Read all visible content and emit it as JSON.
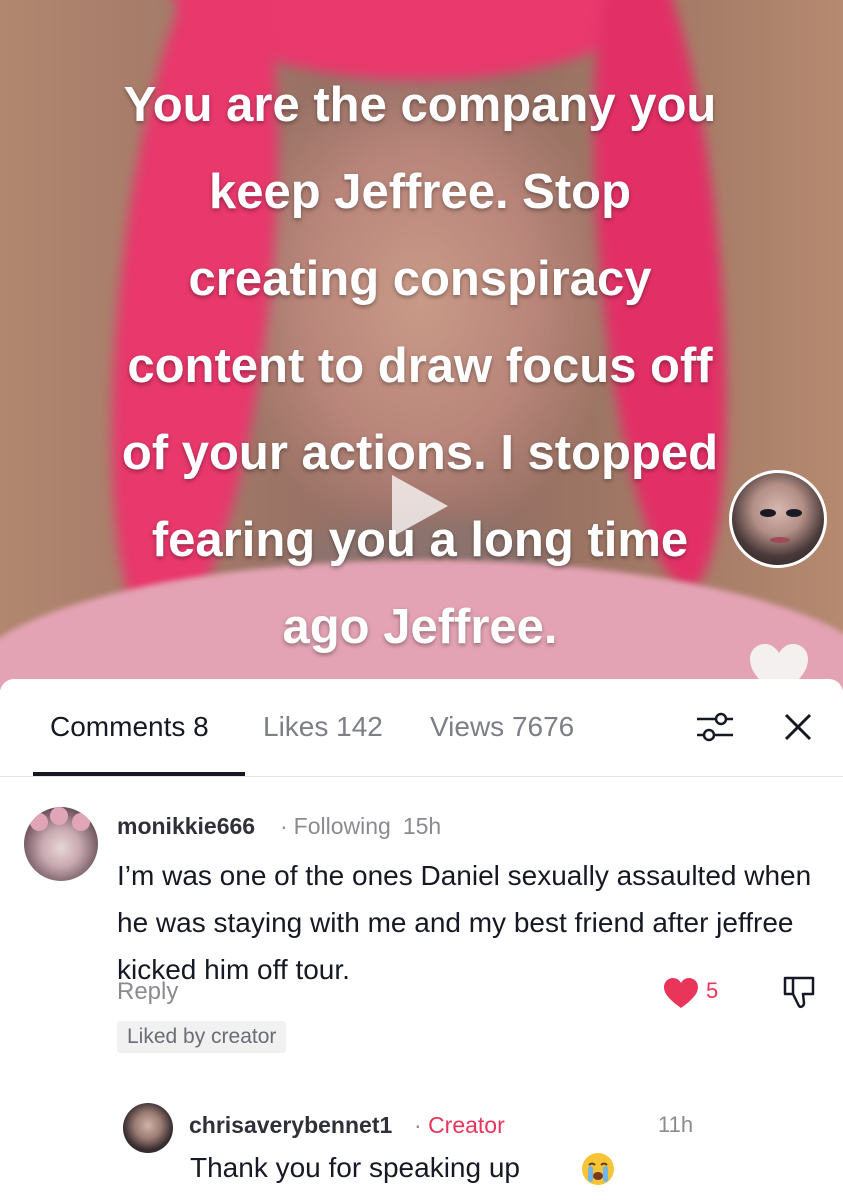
{
  "video": {
    "overlay_lines": [
      "You are the company you",
      "keep Jeffree. Stop",
      "creating conspiracy",
      "content to draw focus off",
      "of your actions. I stopped",
      "fearing you a long time",
      "ago Jeffree."
    ]
  },
  "tabs": {
    "comments": "Comments 8",
    "likes": "Likes 142",
    "views": "Views 7676"
  },
  "comment": {
    "username": "monikkie666",
    "relationship": "Following",
    "time": "15h",
    "text": "I’m was one of the ones Daniel sexually assaulted when he was staying with me and my best friend after jeffree kicked him off tour.",
    "reply_label": "Reply",
    "like_count": "5",
    "liked_badge": "Liked by creator"
  },
  "reply": {
    "username": "chrisaverybennet1",
    "role": "Creator",
    "time": "11h",
    "text": "Thank you for speaking up"
  },
  "colors": {
    "accent": "#e9355a",
    "hair": "#e8386c"
  }
}
